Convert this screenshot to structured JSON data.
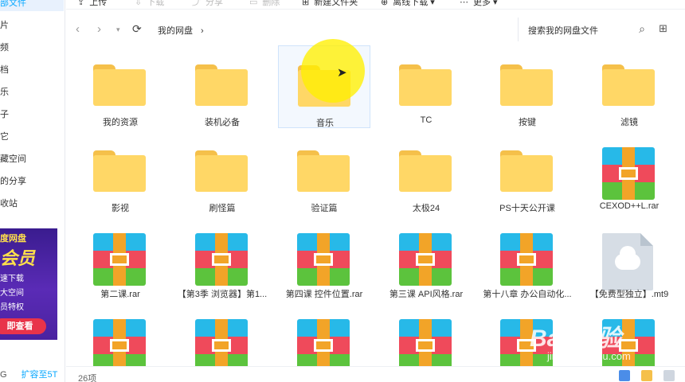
{
  "sidebar": {
    "items": [
      {
        "label": "部文件",
        "active": true
      },
      {
        "label": "片",
        "active": false
      },
      {
        "label": "频",
        "active": false
      },
      {
        "label": "档",
        "active": false
      },
      {
        "label": "乐",
        "active": false
      },
      {
        "label": "子",
        "active": false
      },
      {
        "label": "它",
        "active": false
      },
      {
        "label": "藏空间",
        "active": false
      },
      {
        "label": "的分享",
        "active": false
      },
      {
        "label": "收站",
        "active": false
      }
    ],
    "banner": {
      "line1": "度网盘",
      "line2": "会员",
      "line3": "速下载",
      "line4": "大空间",
      "line5": "员特权",
      "button": "即查看"
    },
    "storage": "G",
    "expand": "扩容至5T"
  },
  "toolbar": {
    "upload": "上传",
    "download": "下载",
    "share": "分享",
    "delete": "删除",
    "new_folder": "新建文件夹",
    "offline_download": "离线下载",
    "more": "更多"
  },
  "addressbar": {
    "crumb": "我的网盘",
    "search_placeholder": "搜索我的网盘文件"
  },
  "files": [
    {
      "name": "我的资源",
      "type": "folder"
    },
    {
      "name": "装机必备",
      "type": "folder"
    },
    {
      "name": "音乐",
      "type": "folder"
    },
    {
      "name": "TC",
      "type": "folder"
    },
    {
      "name": "按键",
      "type": "folder"
    },
    {
      "name": "滤镜",
      "type": "folder"
    },
    {
      "name": "影视",
      "type": "folder"
    },
    {
      "name": "刷怪篇",
      "type": "folder"
    },
    {
      "name": "验证篇",
      "type": "folder"
    },
    {
      "name": "太极24",
      "type": "folder"
    },
    {
      "name": "PS十天公开课",
      "type": "folder"
    },
    {
      "name": "CEXOD++L.rar",
      "type": "rar"
    },
    {
      "name": "第二课.rar",
      "type": "rar"
    },
    {
      "name": "【第3季 浏览器】第1...",
      "type": "rar"
    },
    {
      "name": "第四课 控件位置.rar",
      "type": "rar"
    },
    {
      "name": "第三课 API风格.rar",
      "type": "rar"
    },
    {
      "name": "第十八章 办公自动化...",
      "type": "rar"
    },
    {
      "name": "【免费型独立】.mt9",
      "type": "cloud"
    },
    {
      "name": "",
      "type": "rar"
    },
    {
      "name": "",
      "type": "rar"
    },
    {
      "name": "",
      "type": "rar"
    },
    {
      "name": "",
      "type": "rar"
    },
    {
      "name": "",
      "type": "rar"
    },
    {
      "name": "",
      "type": "rar"
    }
  ],
  "selected_file": "音乐",
  "status": {
    "count": "26项"
  },
  "watermark": {
    "brand": "Bai 经验",
    "url": "jingyan.baidu.com"
  },
  "colors": {
    "accent": "#06a7ff",
    "folder": "#ffd766",
    "highlight": "#fff000"
  }
}
